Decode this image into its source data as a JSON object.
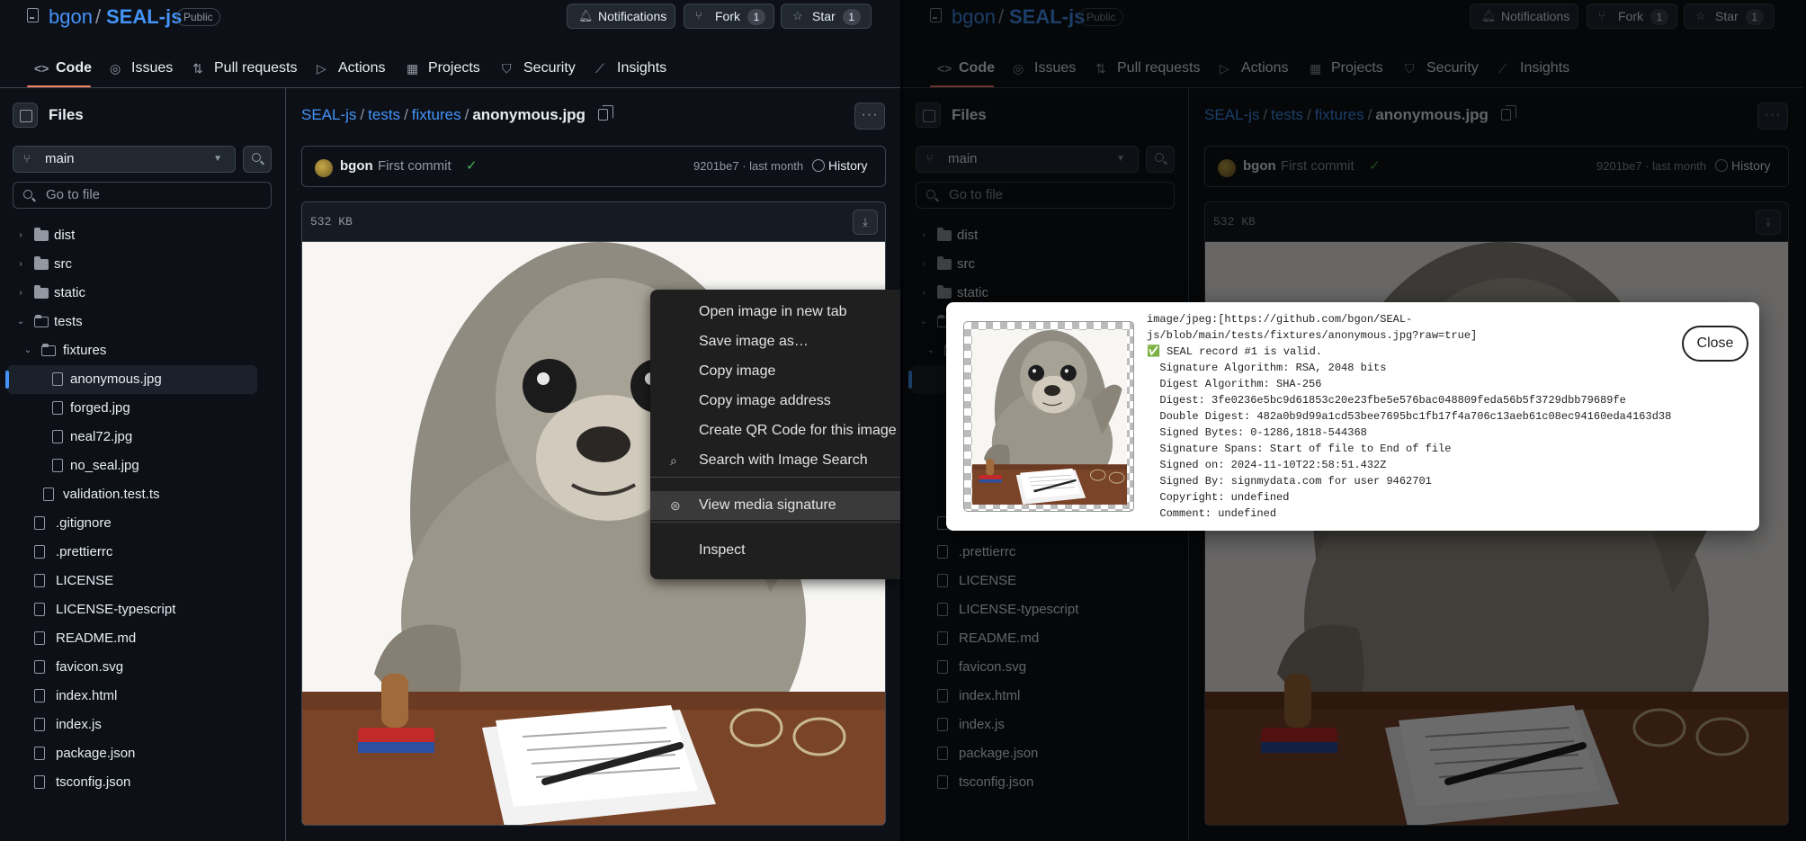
{
  "repo": {
    "owner": "bgon",
    "slash": "/",
    "name": "SEAL-js",
    "visibility": "Public"
  },
  "header_buttons": {
    "notifications": {
      "label": "Notifications",
      "icon": "bell-icon"
    },
    "fork": {
      "label": "Fork",
      "count": "1",
      "icon": "fork-icon"
    },
    "star": {
      "label": "Star",
      "count": "1",
      "icon": "star-icon"
    }
  },
  "tabs": [
    {
      "label": "Code",
      "icon": "code-icon"
    },
    {
      "label": "Issues",
      "icon": "issue-icon"
    },
    {
      "label": "Pull requests",
      "icon": "pull-request-icon"
    },
    {
      "label": "Actions",
      "icon": "play-icon"
    },
    {
      "label": "Projects",
      "icon": "table-icon"
    },
    {
      "label": "Security",
      "icon": "shield-icon"
    },
    {
      "label": "Insights",
      "icon": "graph-icon"
    }
  ],
  "sidebar": {
    "title": "Files",
    "branch": "main",
    "goto_placeholder": "Go to file",
    "tree": [
      {
        "name": "dist",
        "type": "folder"
      },
      {
        "name": "src",
        "type": "folder"
      },
      {
        "name": "static",
        "type": "folder"
      },
      {
        "name": "tests",
        "type": "folder-open"
      },
      {
        "name": "fixtures",
        "type": "folder-open"
      },
      {
        "name": "anonymous.jpg",
        "type": "file",
        "selected": true
      },
      {
        "name": "forged.jpg",
        "type": "file"
      },
      {
        "name": "neal72.jpg",
        "type": "file"
      },
      {
        "name": "no_seal.jpg",
        "type": "file"
      },
      {
        "name": "validation.test.ts",
        "type": "file"
      },
      {
        "name": ".gitignore",
        "type": "file"
      },
      {
        "name": ".prettierrc",
        "type": "file"
      },
      {
        "name": "LICENSE",
        "type": "file"
      },
      {
        "name": "LICENSE-typescript",
        "type": "file"
      },
      {
        "name": "README.md",
        "type": "file"
      },
      {
        "name": "favicon.svg",
        "type": "file"
      },
      {
        "name": "index.html",
        "type": "file"
      },
      {
        "name": "index.js",
        "type": "file"
      },
      {
        "name": "package.json",
        "type": "file"
      },
      {
        "name": "tsconfig.json",
        "type": "file"
      }
    ]
  },
  "breadcrumb": {
    "repo": "SEAL-js",
    "dir1": "tests",
    "dir2": "fixtures",
    "file": "anonymous.jpg",
    "sep": "/"
  },
  "commit": {
    "author": "bgon",
    "message": "First commit",
    "check": "✓",
    "meta": "9201be7 · last month",
    "history": "History"
  },
  "file": {
    "size": "532 KB"
  },
  "context_menu": [
    {
      "label": "Open image in new tab"
    },
    {
      "label": "Save image as…"
    },
    {
      "label": "Copy image"
    },
    {
      "label": "Copy image address"
    },
    {
      "label": "Create QR Code for this image"
    },
    {
      "label": "Search with Image Search",
      "icon": "search-icon"
    },
    {
      "label": "View media signature",
      "icon": "signature-icon",
      "highlighted": true
    },
    {
      "label": "Inspect"
    }
  ],
  "signature_dialog": {
    "lines": [
      "image/jpeg:[https://github.com/bgon/SEAL-",
      "js/blob/main/tests/fixtures/anonymous.jpg?raw=true]",
      "✅ SEAL record #1 is valid.",
      "  Signature Algorithm: RSA, 2048 bits",
      "  Digest Algorithm: SHA-256",
      "  Digest: 3fe0236e5bc9d61853c20e23fbe5e576bac048809feda56b5f3729dbb79689fe",
      "  Double Digest: 482a0b9d99a1cd53bee7695bc1fb17f4a706c13aeb61c08ec94160eda4163d38",
      "  Signed Bytes: 0-1286,1818-544368",
      "  Signature Spans: Start of file to End of file",
      "  Signed on: 2024-11-10T22:58:51.432Z",
      "  Signed By: signmydata.com for user 9462701",
      "  Copyright: undefined",
      "  Comment: undefined"
    ],
    "close_label": "Close"
  },
  "colors": {
    "accent": "#4493f8",
    "bg": "#0d1117",
    "border": "#3d444d",
    "tab_underline": "#f78166",
    "success": "#3fb950"
  }
}
